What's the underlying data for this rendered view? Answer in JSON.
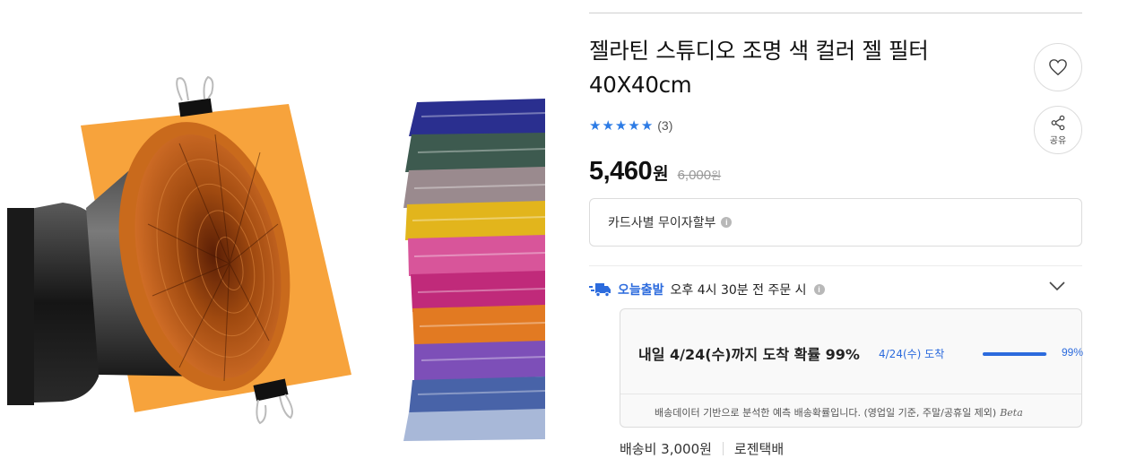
{
  "product": {
    "title_line1": "젤라틴 스튜디오 조명 색 컬러 젤 필터",
    "title_line2": "40X40cm",
    "rating_stars": 5,
    "review_count": "(3)",
    "price": "5,460",
    "price_unit": "원",
    "original_price": "6,000",
    "original_price_unit": "원"
  },
  "actions": {
    "heart_icon": "heart-icon",
    "share_icon": "share-icon",
    "share_label": "공유"
  },
  "card": {
    "label": "카드사별 무이자할부",
    "info_icon": "i"
  },
  "shipping": {
    "badge_icon": "truck-icon",
    "today_label": "오늘출발",
    "condition": "오후 4시 30분 전 주문 시",
    "info_icon": "i",
    "prediction_title": "내일 4/24(수)까지 도착 확률 99%",
    "prediction_date": "4/24(수) 도착",
    "prediction_percent": "99%",
    "prediction_value": 0.99,
    "note": "배송데이터 기반으로 분석한 예측 배송확률입니다. (영업일 기준, 주말/공휴일 제외)",
    "beta": "Beta",
    "fee": "배송비 3,000원",
    "carrier": "로젠택배"
  },
  "colors": {
    "accent": "#2c6bdd",
    "star": "#2c7be5",
    "filter_orange": "#f7a33c"
  }
}
